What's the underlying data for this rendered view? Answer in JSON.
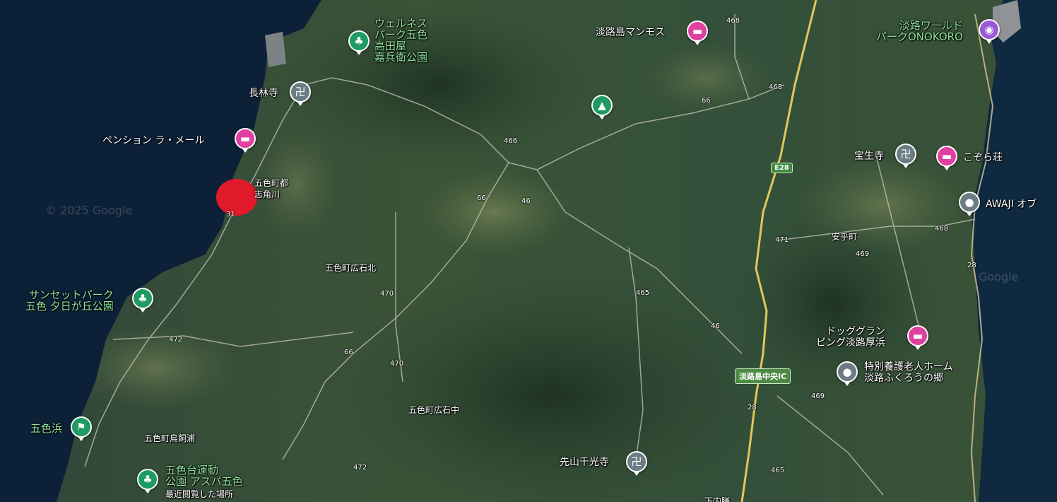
{
  "map": {
    "watermark": "© 2025 Google",
    "watermark2": "Google",
    "places": {
      "wellness_park": "ウェルネス\nパーク五色\n高田屋\n嘉兵衛公園",
      "mammoth": "淡路島マンモス",
      "world_park": "淡路ワールド\nパークONOKORO",
      "chorinji": "長林寺",
      "pension": "ペンション ラ・メール",
      "shikakugawa": "五色町都\n志角川",
      "hoshoji": "宝生寺",
      "kozoraso": "こぞら荘",
      "awaji_of": "AWAJI オブ",
      "anpei": "安乎町",
      "hiroishi_kita": "五色町広石北",
      "sunset_park": "サンセットパーク\n五色 夕日が丘公園",
      "dog_glamping": "ドッググラン\nピング淡路厚浜",
      "nursing_home": "特別養護老人ホーム\n淡路ふくろうの郷",
      "goshikihama": "五色浜",
      "hiroishi_naka": "五色町広石中",
      "torikaiura": "五色町鳥飼浦",
      "goshikidai": "五色台運動\n公園 アスパ五色",
      "recent": "最近閲覧した場所",
      "senkoji": "先山千光寺",
      "bottom_cut": "下内膳"
    },
    "roads": {
      "r468a": "468",
      "r468b": "468",
      "r468c": "468",
      "r66a": "66",
      "r66b": "66",
      "r66c": "66",
      "r466": "466",
      "r46a": "46",
      "r46b": "46",
      "r471": "471",
      "r469a": "469",
      "r469b": "469",
      "r28a": "28",
      "r28b": "28",
      "r470a": "470",
      "r470b": "470",
      "r472a": "472",
      "r472b": "472",
      "r465a": "465",
      "r465b": "465",
      "r31": "31"
    },
    "shields": {
      "e28": "E28",
      "ic": "淡路島中央IC"
    },
    "icons": {
      "wellness": "tree",
      "mammoth": "hotel",
      "world": "amusement",
      "chorinji": "temple",
      "pension": "hotel",
      "camp": "campground",
      "hoshoji": "temple",
      "kozoraso": "hotel",
      "awaji": "place",
      "sunset": "tree",
      "dog": "hotel",
      "nursing": "place",
      "goshikihama": "beach",
      "goshikidai": "tree",
      "senkoji": "temple"
    },
    "colors": {
      "sea": "#0c2138",
      "marker": "#e0192b",
      "green_label": "#8fe29a"
    }
  }
}
